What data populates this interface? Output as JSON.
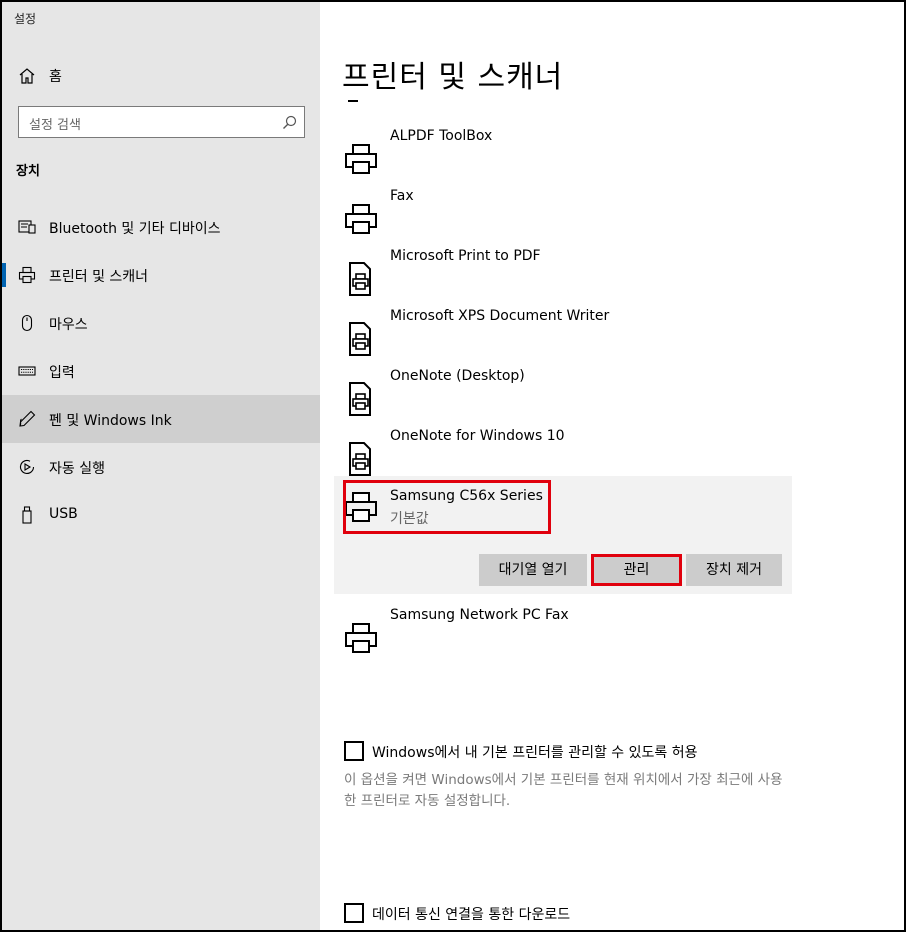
{
  "app": {
    "title": "설정"
  },
  "nav": {
    "home_label": "홈",
    "search_placeholder": "설정 검색",
    "section_title": "장치",
    "items": [
      {
        "label": "Bluetooth 및 기타 디바이스",
        "icon": "bluetooth-devices-icon"
      },
      {
        "label": "프린터 및 스캐너",
        "icon": "printer-icon",
        "selected": true
      },
      {
        "label": "마우스",
        "icon": "mouse-icon"
      },
      {
        "label": "입력",
        "icon": "keyboard-icon"
      },
      {
        "label": "펜 및 Windows Ink",
        "icon": "pen-icon",
        "hovered": true
      },
      {
        "label": "자동 실행",
        "icon": "autoplay-icon"
      },
      {
        "label": "USB",
        "icon": "usb-icon"
      }
    ]
  },
  "main": {
    "title": "프린터 및 스캐너",
    "printers": [
      {
        "name": "ALPDF ToolBox",
        "icon": "printer-icon"
      },
      {
        "name": "Fax",
        "icon": "printer-icon"
      },
      {
        "name": "Microsoft Print to PDF",
        "icon": "document-printer-icon"
      },
      {
        "name": "Microsoft XPS Document Writer",
        "icon": "document-printer-icon"
      },
      {
        "name": "OneNote (Desktop)",
        "icon": "document-printer-icon"
      },
      {
        "name": "OneNote for Windows 10",
        "icon": "document-printer-icon"
      },
      {
        "name": "Samsung C56x Series",
        "subtitle": "기본값",
        "icon": "printer-icon",
        "selected": true
      },
      {
        "name": "Samsung Network PC Fax",
        "icon": "printer-icon"
      }
    ],
    "buttons": {
      "open_queue": "대기열 열기",
      "manage": "관리",
      "remove": "장치 제거"
    },
    "default_printer_checkbox": {
      "label": "Windows에서 내 기본 프린터를 관리할 수 있도록 허용",
      "description": "이 옵션을 켜면 Windows에서 기본 프린터를 현재 위치에서 가장 최근에 사용한 프린터로 자동 설정합니다.",
      "checked": false
    },
    "metered_checkbox": {
      "label": "데이터 통신 연결을 통한 다운로드",
      "checked": false
    }
  },
  "colors": {
    "accent": "#0063b1",
    "highlight": "#e0000d"
  }
}
